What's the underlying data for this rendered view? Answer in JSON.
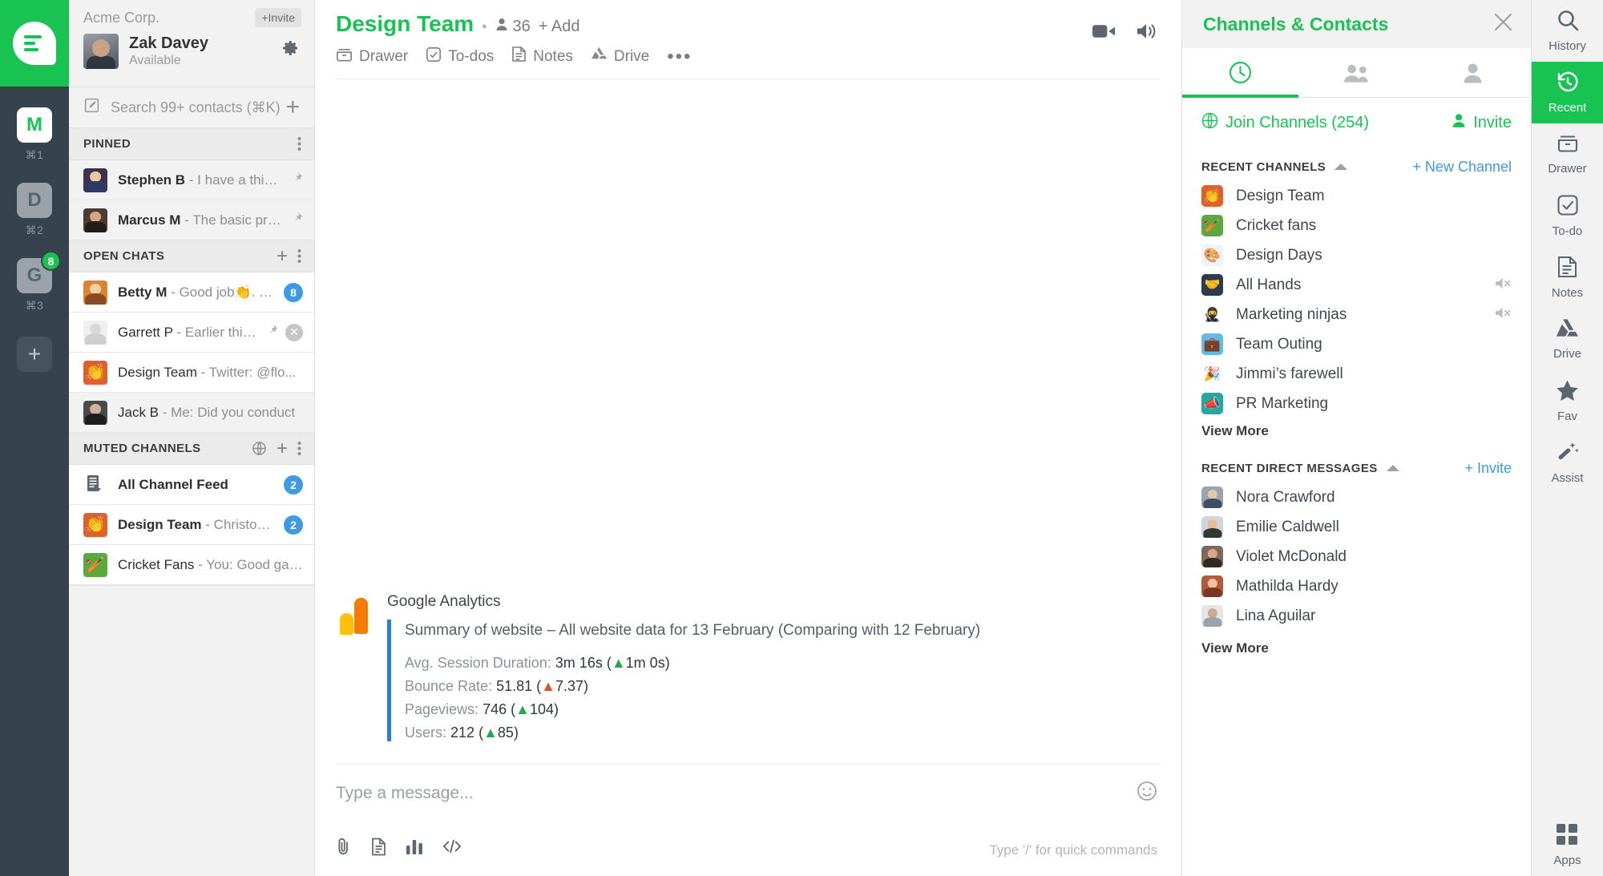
{
  "rail": {
    "logo_icon": "flock-logo-icon",
    "workspaces": [
      {
        "letter": "M",
        "shortcut": "⌘1",
        "active": true,
        "badge": ""
      },
      {
        "letter": "D",
        "shortcut": "⌘2",
        "active": false,
        "badge": ""
      },
      {
        "letter": "G",
        "shortcut": "⌘3",
        "active": false,
        "badge": "8"
      }
    ],
    "add_label": "+"
  },
  "sidebar": {
    "org": "Acme Corp.",
    "invite_label": "+Invite",
    "user": {
      "name": "Zak Davey",
      "status": "Available"
    },
    "search": {
      "placeholder": "Search 99+ contacts (⌘K)",
      "add_label": "+"
    },
    "sections": [
      {
        "title": "PINNED"
      },
      {
        "title": "OPEN CHATS"
      },
      {
        "title": "MUTED CHANNELS"
      }
    ],
    "pinned": [
      {
        "name": "Stephen B",
        "preview": "- I have a thing for",
        "pinned": true
      },
      {
        "name": "Marcus M",
        "preview": "- The basic proced...",
        "pinned": true
      }
    ],
    "open_chats": [
      {
        "name": "Betty M",
        "preview": "- Good job👏. This h...",
        "badge": "8",
        "bold": true
      },
      {
        "name": "Garrett P",
        "preview": "- Earlier this year...",
        "pinned": true,
        "close": true
      },
      {
        "name": "Design Team",
        "preview": "- Twitter: @flo..."
      },
      {
        "name": "Jack B",
        "preview": "- Me: Did you conduct"
      }
    ],
    "muted_channels": [
      {
        "name": "All Channel Feed",
        "preview": "",
        "badge": "2",
        "bold": true
      },
      {
        "name": "Design Team",
        "preview": "- Christopher J:",
        "badge": "2",
        "bold": true
      },
      {
        "name": "Cricket Fans",
        "preview": "- You: Good game"
      }
    ]
  },
  "main": {
    "channel": "Design Team",
    "member_count": "36",
    "add_label": "+ Add",
    "tabs": [
      {
        "label": "Drawer",
        "icon": "drawer-icon"
      },
      {
        "label": "To-dos",
        "icon": "checkbox-icon"
      },
      {
        "label": "Notes",
        "icon": "notes-icon"
      },
      {
        "label": "Drive",
        "icon": "drive-icon"
      }
    ],
    "more_label": "•••",
    "message": {
      "app_name": "Google Analytics",
      "summary": "Summary of website – All website data for 13 February (Comparing with 12 February)",
      "stats": [
        {
          "label": "Avg. Session Duration:",
          "value": "3m 16s",
          "delta": "1m 0s",
          "dir": "up",
          "color": "green"
        },
        {
          "label": "Bounce Rate:",
          "value": "51.81",
          "delta": "7.37",
          "dir": "up",
          "color": "red"
        },
        {
          "label": "Pageviews:",
          "value": "746",
          "delta": "104",
          "dir": "up",
          "color": "green"
        },
        {
          "label": "Users:",
          "value": "212",
          "delta": "85",
          "dir": "up",
          "color": "green"
        }
      ]
    },
    "composer": {
      "placeholder": "Type a message...",
      "hint": "Type '/' for quick commands",
      "tools": [
        "attach-icon",
        "document-icon",
        "poll-icon",
        "code-icon"
      ]
    }
  },
  "right_panel": {
    "title": "Channels & Contacts",
    "tabs": [
      {
        "icon": "recent-clock-icon",
        "active": true
      },
      {
        "icon": "group-icon",
        "active": false
      },
      {
        "icon": "person-icon",
        "active": false
      }
    ],
    "join_label": "Join Channels (254)",
    "invite_label": "Invite",
    "channels_section": {
      "title": "RECENT CHANNELS",
      "action": "+ New Channel",
      "items": [
        {
          "name": "Design Team",
          "muted": false
        },
        {
          "name": "Cricket fans",
          "muted": false
        },
        {
          "name": "Design Days",
          "muted": false
        },
        {
          "name": "All Hands",
          "muted": true
        },
        {
          "name": "Marketing ninjas",
          "muted": true
        },
        {
          "name": "Team Outing",
          "muted": false
        },
        {
          "name": "Jimmi’s farewell",
          "muted": false
        },
        {
          "name": "PR Marketing",
          "muted": false
        }
      ],
      "view_more": "View More"
    },
    "dm_section": {
      "title": "RECENT DIRECT MESSAGES",
      "action": "+ Invite",
      "items": [
        {
          "name": "Nora Crawford"
        },
        {
          "name": "Emilie Caldwell"
        },
        {
          "name": "Violet McDonald"
        },
        {
          "name": "Mathilda Hardy"
        },
        {
          "name": "Lina Aguilar"
        }
      ],
      "view_more": "View More"
    }
  },
  "right_toolbar": {
    "items": [
      {
        "label": "History",
        "icon": "search-icon",
        "active": false
      },
      {
        "label": "Recent",
        "icon": "history-clock-icon",
        "active": true
      },
      {
        "label": "Drawer",
        "icon": "drawer-icon",
        "active": false
      },
      {
        "label": "To-do",
        "icon": "checkbox-icon",
        "active": false
      },
      {
        "label": "Notes",
        "icon": "notes-icon",
        "active": false
      },
      {
        "label": "Drive",
        "icon": "drive-icon",
        "active": false
      },
      {
        "label": "Fav",
        "icon": "star-icon",
        "active": false
      },
      {
        "label": "Assist",
        "icon": "magic-wand-icon",
        "active": false
      },
      {
        "label": "Apps",
        "icon": "apps-grid-icon",
        "active": false
      }
    ]
  },
  "colors": {
    "brand_green": "#18c352",
    "rail_dark": "#36424c",
    "badge_blue": "#3e9ae4"
  }
}
